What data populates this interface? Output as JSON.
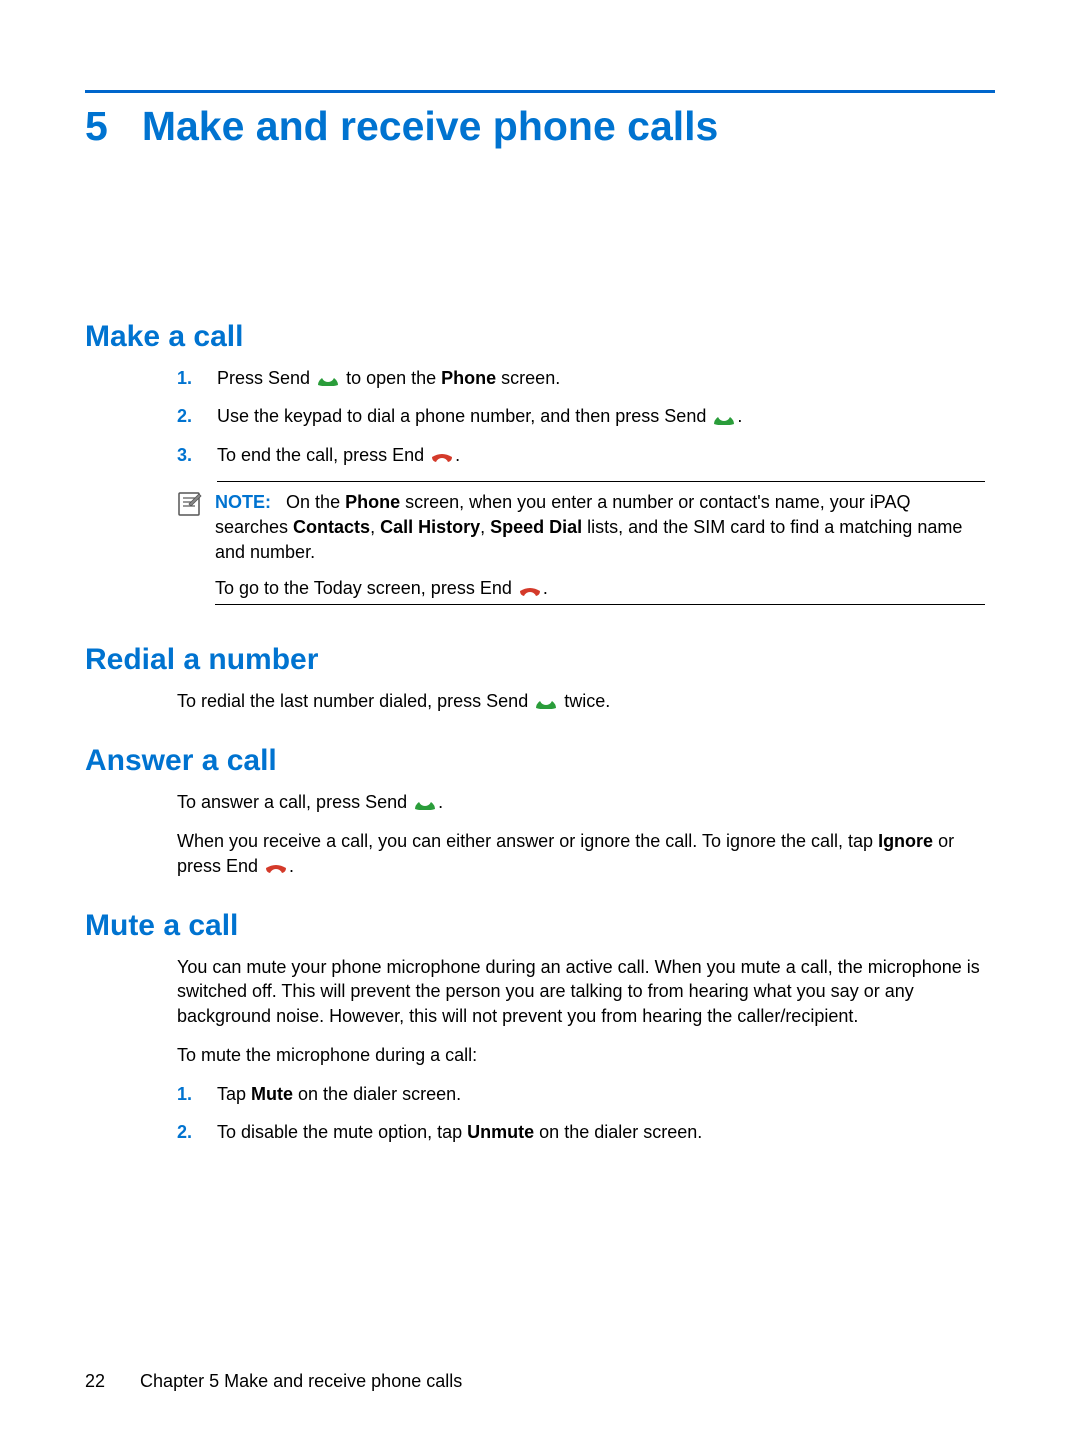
{
  "chapter": {
    "number": "5",
    "title": "Make and receive phone calls"
  },
  "sections": {
    "make_a_call": {
      "heading": "Make a call",
      "steps": [
        {
          "pre": "Press Send ",
          "post": " to open the ",
          "bold1": "Phone",
          "after_bold": " screen."
        },
        {
          "pre": "Use the keypad to dial a phone number, and then press Send ",
          "post": "."
        },
        {
          "pre": "To end the call, press End ",
          "post": "."
        }
      ],
      "note": {
        "label": "NOTE:",
        "line1_a": "On the ",
        "line1_b1": "Phone",
        "line1_c": " screen, when you enter a number or contact's name, your iPAQ searches ",
        "line2_b1": "Contacts",
        "line2_sep1": ", ",
        "line2_b2": "Call History",
        "line2_sep2": ", ",
        "line2_b3": "Speed Dial",
        "line2_c": " lists, and the SIM card to find a matching name and number.",
        "sub_pre": "To go to the Today screen, press End ",
        "sub_post": "."
      }
    },
    "redial": {
      "heading": "Redial a number",
      "para_pre": "To redial the last number dialed, press Send ",
      "para_post": " twice."
    },
    "answer": {
      "heading": "Answer a call",
      "p1_pre": "To answer a call, press Send ",
      "p1_post": ".",
      "p2_pre": "When you receive a call, you can either answer or ignore the call. To ignore the call, tap ",
      "p2_bold": "Ignore",
      "p2_mid": " or press End ",
      "p2_post": "."
    },
    "mute": {
      "heading": "Mute a call",
      "p1": "You can mute your phone microphone during an active call. When you mute a call, the microphone is switched off. This will prevent the person you are talking to from hearing what you say or any background noise. However, this will not prevent you from hearing the caller/recipient.",
      "p2": "To mute the microphone during a call:",
      "steps": [
        {
          "pre": "Tap ",
          "bold": "Mute",
          "post": " on the dialer screen."
        },
        {
          "pre": "To disable the mute option, tap ",
          "bold": "Unmute",
          "post": " on the dialer screen."
        }
      ]
    }
  },
  "footer": {
    "page_number": "22",
    "chapter_label": "Chapter 5   Make and receive phone calls"
  }
}
